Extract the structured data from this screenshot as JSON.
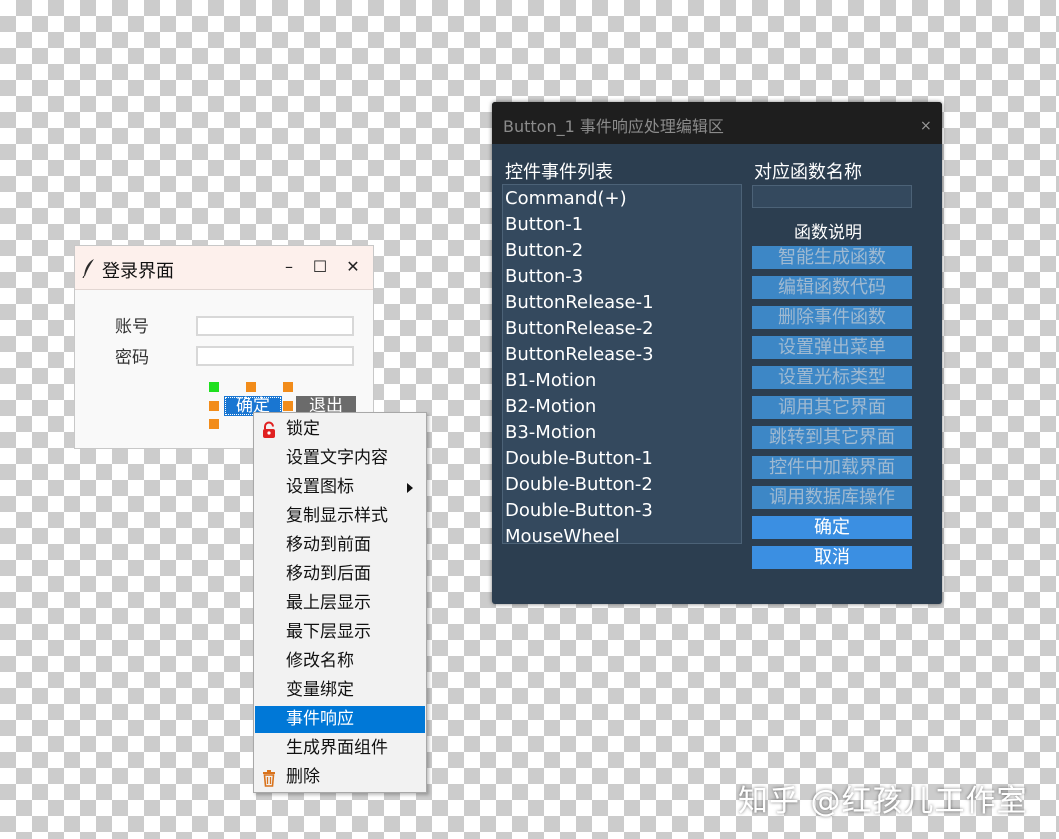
{
  "login_window": {
    "title": "登录界面",
    "controls": {
      "minimize": "–",
      "maximize": "☐",
      "close": "✕"
    },
    "account_label": "账号",
    "password_label": "密码",
    "account_value": "",
    "password_value": "",
    "ok_button": "确定",
    "exit_button": "退出"
  },
  "context_menu": {
    "items": [
      {
        "label": "锁定",
        "icon": "lock-icon"
      },
      {
        "label": "设置文字内容"
      },
      {
        "label": "设置图标",
        "submenu": true
      },
      {
        "label": "复制显示样式"
      },
      {
        "label": "移动到前面"
      },
      {
        "label": "移动到后面"
      },
      {
        "label": "最上层显示"
      },
      {
        "label": "最下层显示"
      },
      {
        "label": "修改名称"
      },
      {
        "label": "变量绑定"
      },
      {
        "label": "事件响应",
        "active": true
      },
      {
        "label": "生成界面组件"
      },
      {
        "label": "删除",
        "icon": "trash-icon"
      }
    ]
  },
  "event_dialog": {
    "title": "Button_1 事件响应处理编辑区",
    "close": "×",
    "events_label": "控件事件列表",
    "function_name_label": "对应函数名称",
    "function_name_value": "",
    "function_desc_label": "函数说明",
    "events": [
      "Command(+)",
      "Button-1",
      "Button-2",
      "Button-3",
      "ButtonRelease-1",
      "ButtonRelease-2",
      "ButtonRelease-3",
      "B1-Motion",
      "B2-Motion",
      "B3-Motion",
      "Double-Button-1",
      "Double-Button-2",
      "Double-Button-3",
      "MouseWheel"
    ],
    "buttons": [
      {
        "label": "智能生成函数",
        "enabled": false
      },
      {
        "label": "编辑函数代码",
        "enabled": false
      },
      {
        "label": "删除事件函数",
        "enabled": false
      },
      {
        "label": "设置弹出菜单",
        "enabled": false
      },
      {
        "label": "设置光标类型",
        "enabled": false
      },
      {
        "label": "调用其它界面",
        "enabled": false
      },
      {
        "label": "跳转到其它界面",
        "enabled": false
      },
      {
        "label": "控件中加载界面",
        "enabled": false
      },
      {
        "label": "调用数据库操作",
        "enabled": false
      },
      {
        "label": "确定",
        "enabled": true
      },
      {
        "label": "取消",
        "enabled": true
      }
    ]
  },
  "watermark": "知乎 @红孩儿工作室",
  "colors": {
    "dialog_bg": "#2c3e50",
    "dialog_titlebar": "#1e1e1e",
    "menu_highlight": "#0078d7",
    "button_enabled": "#3b8fe2",
    "button_disabled": "#3d87c6",
    "selection_handle": "#f28c1a",
    "selection_handle_anchor": "#1fe01f"
  }
}
